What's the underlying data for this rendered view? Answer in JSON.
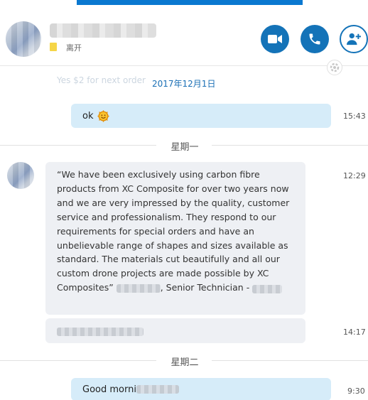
{
  "header": {
    "status_text": "离开",
    "status_color": "#f5d547",
    "actions": [
      {
        "name": "video-call",
        "icon": "video-camera-icon"
      },
      {
        "name": "voice-call",
        "icon": "phone-icon"
      },
      {
        "name": "add-people",
        "icon": "add-person-icon"
      }
    ],
    "accent_color": "#1473b8"
  },
  "conversation": {
    "date_marker": "2017年12月1日",
    "previous_message_faded": "Yes $2 for next order",
    "messages": [
      {
        "direction": "outgoing",
        "text": "ok",
        "emoji": "smile-icon",
        "time": "15:43"
      },
      {
        "direction": "incoming",
        "text_main": "“We have been exclusively using carbon fibre products from XC Composite for over two years now and we are very impressed by the quality, customer service and professionalism. They respond to our requirements for special orders and have an unbelievable range of shapes and sizes available as standard. The materials cut beautifully and all our custom drone projects are made possible by XC Composites”",
        "text_tail": ", Senior Technician -",
        "time": "12:29"
      },
      {
        "direction": "incoming",
        "text": "",
        "time": "14:17"
      },
      {
        "direction": "outgoing",
        "text": "Good morni",
        "time": "9:30"
      }
    ],
    "day_dividers": [
      "星期一",
      "星期二"
    ]
  }
}
